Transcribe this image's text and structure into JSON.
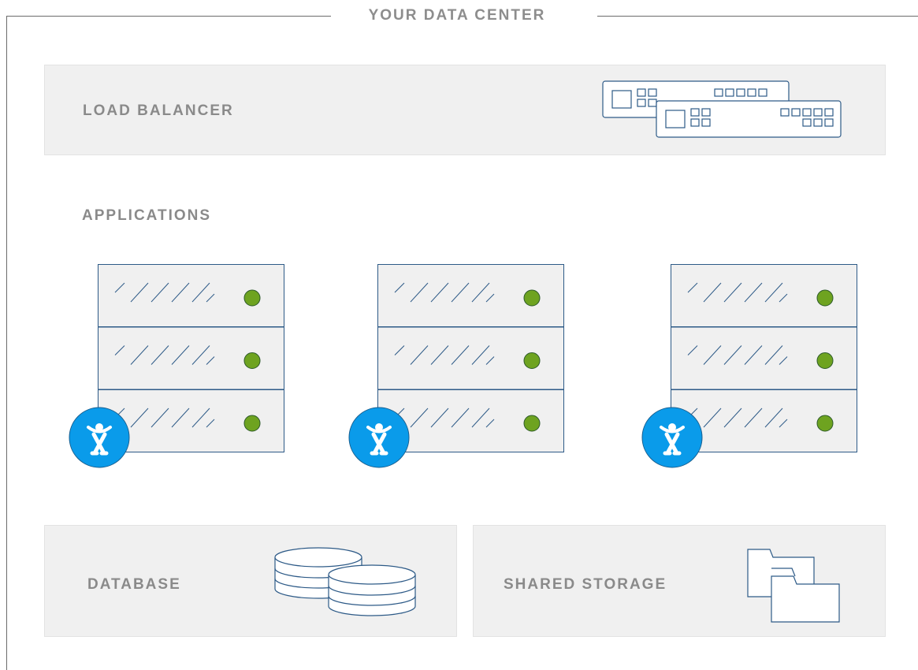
{
  "diagram": {
    "title": "YOUR DATA CENTER",
    "load_balancer": {
      "label": "LOAD BALANCER",
      "icon": "load-balancer-icon"
    },
    "applications": {
      "label": "APPLICATIONS",
      "servers": [
        {
          "icon": "server-rack-icon",
          "badge_icon": "atlassian-logo-icon",
          "status_color": "#6ea320"
        },
        {
          "icon": "server-rack-icon",
          "badge_icon": "atlassian-logo-icon",
          "status_color": "#6ea320"
        },
        {
          "icon": "server-rack-icon",
          "badge_icon": "atlassian-logo-icon",
          "status_color": "#6ea320"
        }
      ]
    },
    "database": {
      "label": "DATABASE",
      "icon": "database-icon"
    },
    "shared_storage": {
      "label": "SHARED STORAGE",
      "icon": "folders-icon"
    },
    "colors": {
      "outline": "#2d5a87",
      "panel_bg": "#f0f0f0",
      "label_text": "#8a8a8a",
      "status_led": "#6ea320",
      "badge_blue": "#0a9bea"
    }
  }
}
